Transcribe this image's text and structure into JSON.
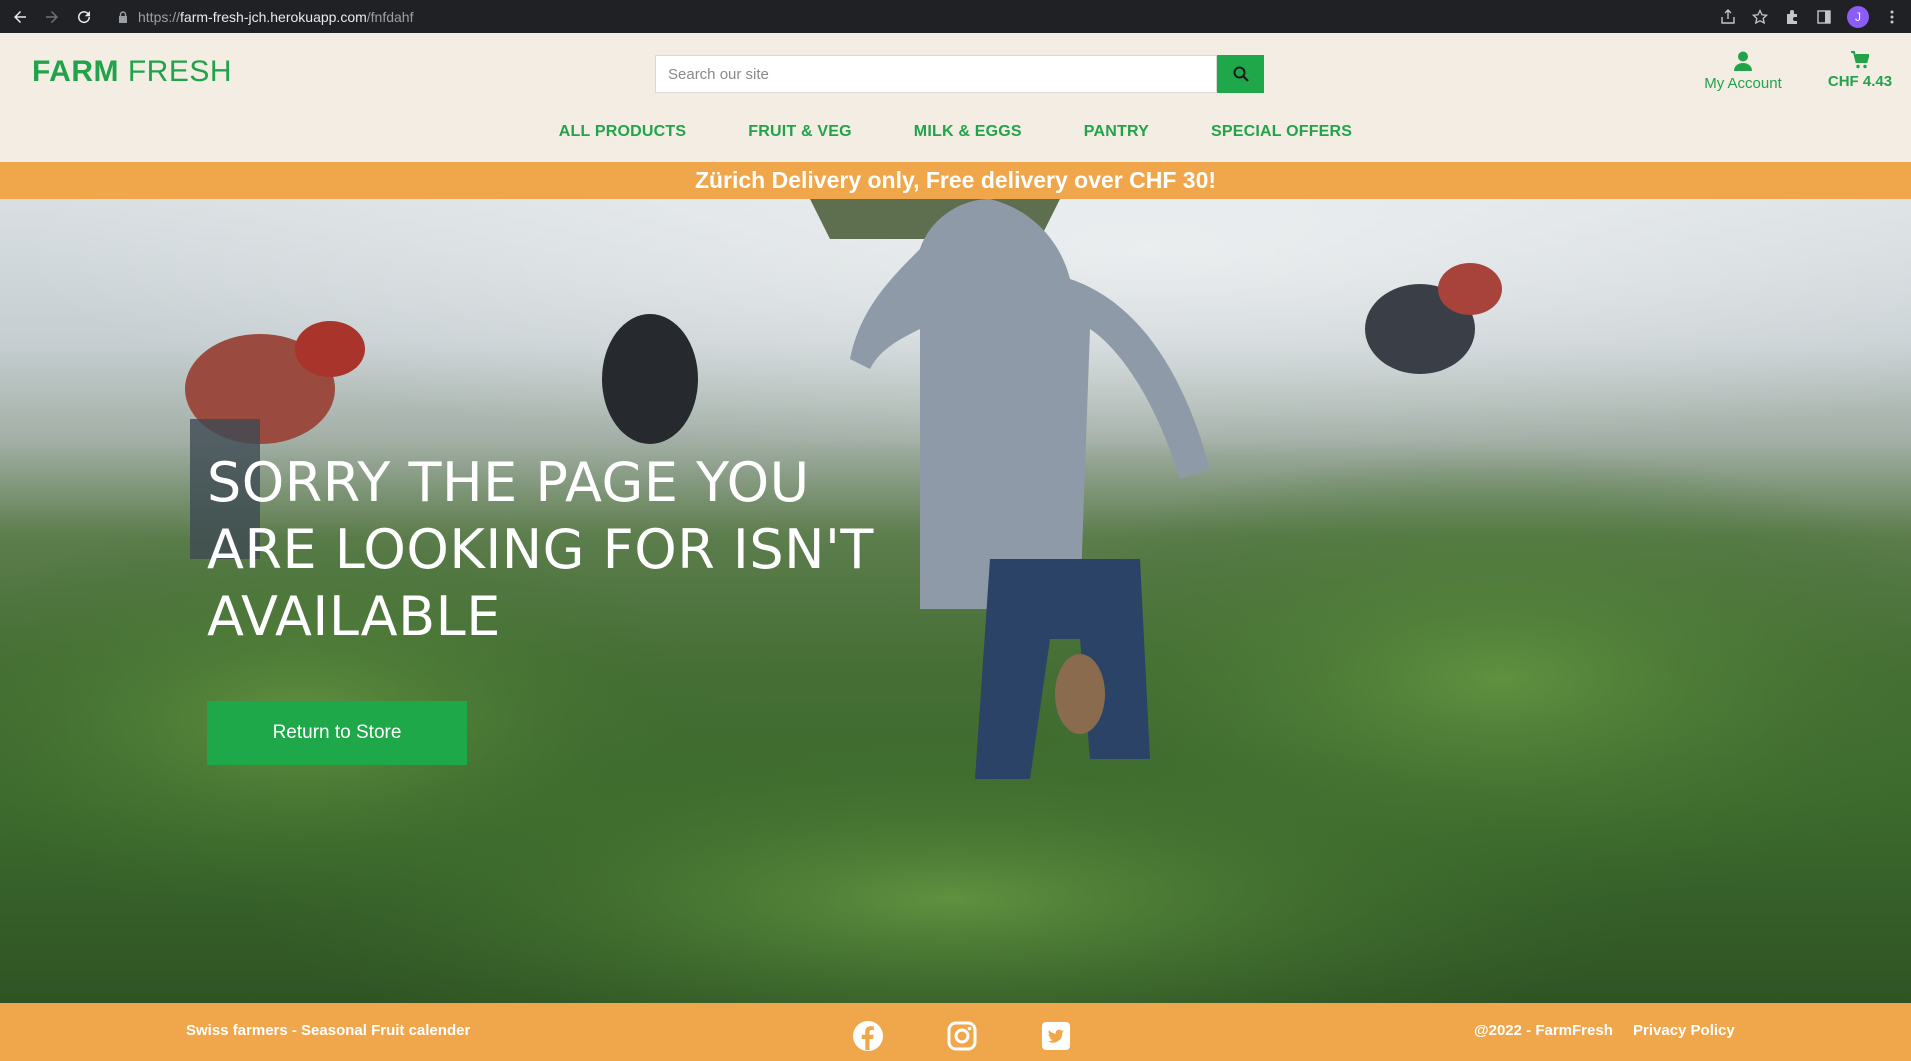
{
  "browser": {
    "url_scheme": "https://",
    "url_host": "farm-fresh-jch.herokuapp.com",
    "url_path": "/fnfdahf",
    "profile_initial": "J"
  },
  "header": {
    "logo_bold": "FARM",
    "logo_light": " FRESH",
    "search_placeholder": "Search our site",
    "account_label": "My Account",
    "basket_total": "CHF 4.43"
  },
  "nav": {
    "items": [
      "ALL PRODUCTS",
      "FRUIT & VEG",
      "MILK & EGGS",
      "PANTRY",
      "SPECIAL OFFERS"
    ]
  },
  "banner": {
    "text": "Zürich Delivery only, Free delivery over CHF 30!"
  },
  "hero": {
    "title": "SORRY THE PAGE YOU ARE LOOKING FOR ISN'T AVAILABLE",
    "button_label": "Return to Store"
  },
  "footer": {
    "left_link": "Swiss farmers - Seasonal Fruit calender",
    "copyright": "@2022 - FarmFresh",
    "privacy": "Privacy Policy",
    "social": [
      "facebook-icon",
      "instagram-icon",
      "twitter-icon"
    ]
  },
  "colors": {
    "brand_green": "#22a34a",
    "accent_orange": "#f0a64a",
    "header_bg": "#f3ede4"
  }
}
